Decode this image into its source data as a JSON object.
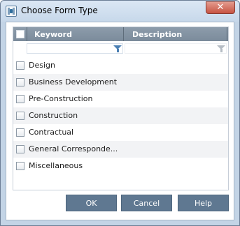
{
  "window": {
    "title": "Choose Form Type",
    "close_glyph": "✕"
  },
  "grid": {
    "columns": [
      "Keyword",
      "Description"
    ],
    "rows": [
      {
        "label": "Design",
        "checked": false
      },
      {
        "label": "Business Development",
        "checked": false
      },
      {
        "label": "Pre-Construction",
        "checked": false
      },
      {
        "label": "Construction",
        "checked": false
      },
      {
        "label": "Contractual",
        "checked": false
      },
      {
        "label": "General Correspondence",
        "display": "General Correspondе...",
        "checked": false
      },
      {
        "label": "Miscellaneous",
        "checked": false
      }
    ]
  },
  "buttons": {
    "ok": "OK",
    "cancel": "Cancel",
    "help": "Help"
  },
  "icons": {
    "app": "form-app-icon",
    "close": "close-icon",
    "filter": "filter-funnel-icon"
  },
  "colors": {
    "header_bg": "#7f8e9e",
    "button_bg": "#5f7891",
    "close_bg": "#c75443",
    "filter_active": "#4a7fb3"
  }
}
